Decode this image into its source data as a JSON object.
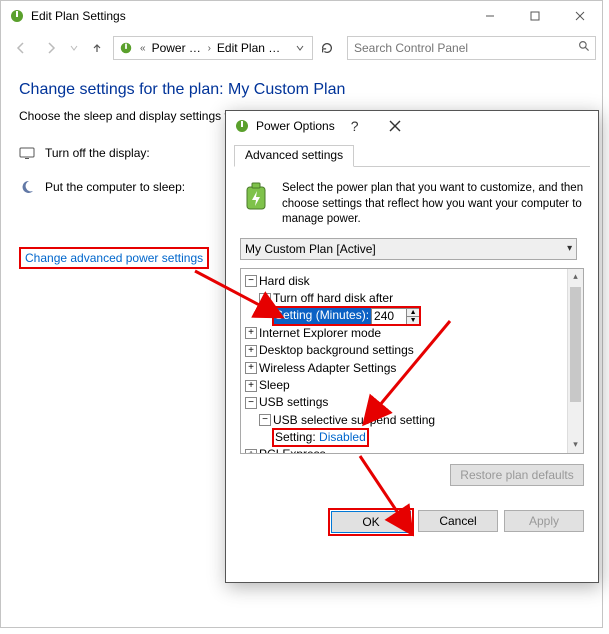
{
  "window": {
    "title": "Edit Plan Settings"
  },
  "toolbar": {
    "breadcrumb": {
      "item1": "Power Options",
      "item2": "Edit Plan Settings"
    },
    "search_placeholder": "Search Control Panel"
  },
  "page": {
    "heading": "Change settings for the plan: My Custom Plan",
    "instruction": "Choose the sleep and display settings that you want your computer to use.",
    "row1_label": "Turn off the display:",
    "row2_label": "Put the computer to sleep:",
    "advanced_link": "Change advanced power settings"
  },
  "dialog": {
    "title": "Power Options",
    "tab": "Advanced settings",
    "description": "Select the power plan that you want to customize, and then choose settings that reflect how you want your computer to manage power.",
    "plan_select": "My Custom Plan [Active]",
    "tree": {
      "hard_disk": "Hard disk",
      "turn_off_hd": "Turn off hard disk after",
      "setting_minutes_label": "Setting (Minutes):",
      "setting_minutes_value": "240",
      "ie_mode": "Internet Explorer mode",
      "desktop_bg": "Desktop background settings",
      "wireless": "Wireless Adapter Settings",
      "sleep": "Sleep",
      "usb": "USB settings",
      "usb_suspend": "USB selective suspend setting",
      "usb_setting_label": "Setting:",
      "usb_setting_value": "Disabled",
      "pci": "PCI Express"
    },
    "buttons": {
      "restore": "Restore plan defaults",
      "ok": "OK",
      "cancel": "Cancel",
      "apply": "Apply"
    }
  }
}
